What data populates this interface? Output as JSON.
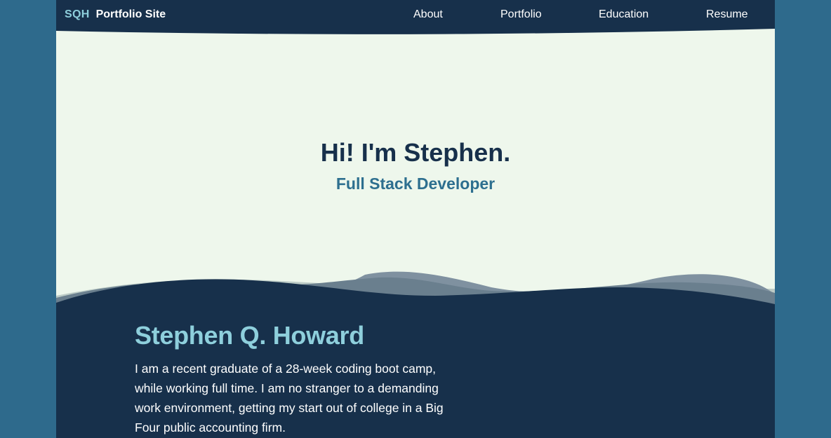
{
  "nav": {
    "brand_mark": "SQH",
    "brand_name": "Portfolio Site",
    "links": [
      "About",
      "Portfolio",
      "Education",
      "Resume"
    ]
  },
  "hero": {
    "title": "Hi! I'm Stephen.",
    "subtitle": "Full Stack Developer"
  },
  "about": {
    "name": "Stephen Q. Howard",
    "text": "I am a recent graduate of a 28-week coding boot camp, while working full time. I am no stranger to a demanding work environment, getting my start out of college in a Big Four public accounting firm."
  },
  "colors": {
    "outer_background": "#2e6a8c",
    "hero_background": "#eef7ec",
    "navy": "#17304b",
    "accent_light_blue": "#8ecfdc",
    "accent_blue": "#2d6f8f"
  }
}
